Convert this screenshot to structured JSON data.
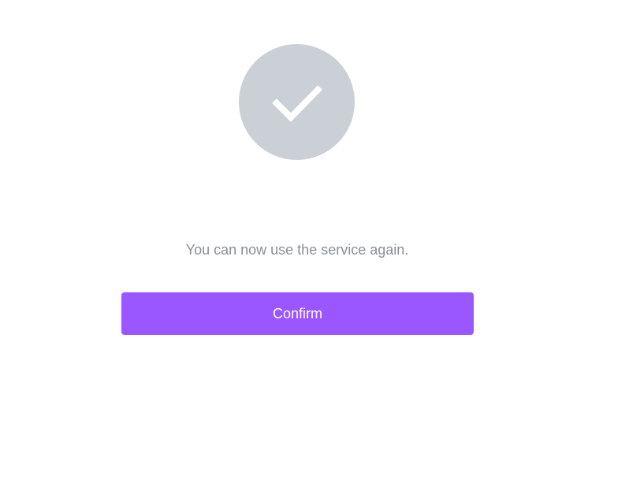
{
  "status": {
    "icon": "checkmark-icon",
    "circle_color": "#cbcfd6",
    "message": "You can now use the service again."
  },
  "actions": {
    "confirm_label": "Confirm",
    "confirm_color": "#9a57ff"
  }
}
